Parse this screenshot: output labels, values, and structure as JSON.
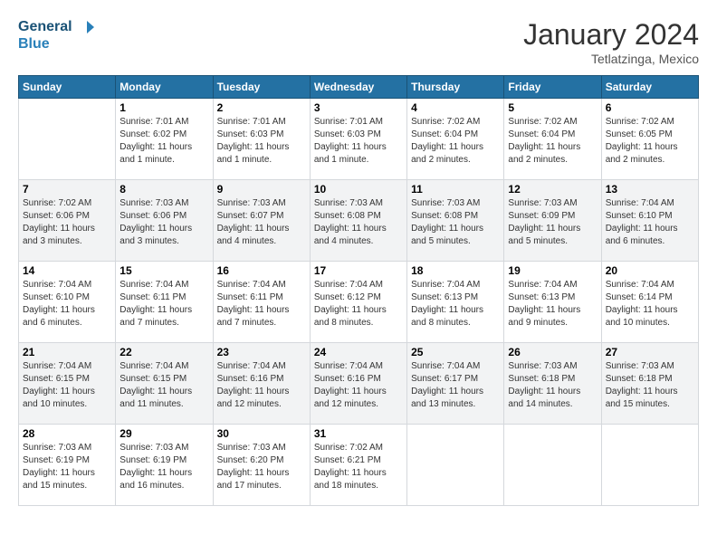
{
  "header": {
    "logo_text_general": "General",
    "logo_text_blue": "Blue",
    "month_year": "January 2024",
    "location": "Tetlatzinga, Mexico"
  },
  "days_of_week": [
    "Sunday",
    "Monday",
    "Tuesday",
    "Wednesday",
    "Thursday",
    "Friday",
    "Saturday"
  ],
  "weeks": [
    [
      {
        "day": "",
        "info": ""
      },
      {
        "day": "1",
        "info": "Sunrise: 7:01 AM\nSunset: 6:02 PM\nDaylight: 11 hours\nand 1 minute."
      },
      {
        "day": "2",
        "info": "Sunrise: 7:01 AM\nSunset: 6:03 PM\nDaylight: 11 hours\nand 1 minute."
      },
      {
        "day": "3",
        "info": "Sunrise: 7:01 AM\nSunset: 6:03 PM\nDaylight: 11 hours\nand 1 minute."
      },
      {
        "day": "4",
        "info": "Sunrise: 7:02 AM\nSunset: 6:04 PM\nDaylight: 11 hours\nand 2 minutes."
      },
      {
        "day": "5",
        "info": "Sunrise: 7:02 AM\nSunset: 6:04 PM\nDaylight: 11 hours\nand 2 minutes."
      },
      {
        "day": "6",
        "info": "Sunrise: 7:02 AM\nSunset: 6:05 PM\nDaylight: 11 hours\nand 2 minutes."
      }
    ],
    [
      {
        "day": "7",
        "info": "Sunrise: 7:02 AM\nSunset: 6:06 PM\nDaylight: 11 hours\nand 3 minutes."
      },
      {
        "day": "8",
        "info": "Sunrise: 7:03 AM\nSunset: 6:06 PM\nDaylight: 11 hours\nand 3 minutes."
      },
      {
        "day": "9",
        "info": "Sunrise: 7:03 AM\nSunset: 6:07 PM\nDaylight: 11 hours\nand 4 minutes."
      },
      {
        "day": "10",
        "info": "Sunrise: 7:03 AM\nSunset: 6:08 PM\nDaylight: 11 hours\nand 4 minutes."
      },
      {
        "day": "11",
        "info": "Sunrise: 7:03 AM\nSunset: 6:08 PM\nDaylight: 11 hours\nand 5 minutes."
      },
      {
        "day": "12",
        "info": "Sunrise: 7:03 AM\nSunset: 6:09 PM\nDaylight: 11 hours\nand 5 minutes."
      },
      {
        "day": "13",
        "info": "Sunrise: 7:04 AM\nSunset: 6:10 PM\nDaylight: 11 hours\nand 6 minutes."
      }
    ],
    [
      {
        "day": "14",
        "info": "Sunrise: 7:04 AM\nSunset: 6:10 PM\nDaylight: 11 hours\nand 6 minutes."
      },
      {
        "day": "15",
        "info": "Sunrise: 7:04 AM\nSunset: 6:11 PM\nDaylight: 11 hours\nand 7 minutes."
      },
      {
        "day": "16",
        "info": "Sunrise: 7:04 AM\nSunset: 6:11 PM\nDaylight: 11 hours\nand 7 minutes."
      },
      {
        "day": "17",
        "info": "Sunrise: 7:04 AM\nSunset: 6:12 PM\nDaylight: 11 hours\nand 8 minutes."
      },
      {
        "day": "18",
        "info": "Sunrise: 7:04 AM\nSunset: 6:13 PM\nDaylight: 11 hours\nand 8 minutes."
      },
      {
        "day": "19",
        "info": "Sunrise: 7:04 AM\nSunset: 6:13 PM\nDaylight: 11 hours\nand 9 minutes."
      },
      {
        "day": "20",
        "info": "Sunrise: 7:04 AM\nSunset: 6:14 PM\nDaylight: 11 hours\nand 10 minutes."
      }
    ],
    [
      {
        "day": "21",
        "info": "Sunrise: 7:04 AM\nSunset: 6:15 PM\nDaylight: 11 hours\nand 10 minutes."
      },
      {
        "day": "22",
        "info": "Sunrise: 7:04 AM\nSunset: 6:15 PM\nDaylight: 11 hours\nand 11 minutes."
      },
      {
        "day": "23",
        "info": "Sunrise: 7:04 AM\nSunset: 6:16 PM\nDaylight: 11 hours\nand 12 minutes."
      },
      {
        "day": "24",
        "info": "Sunrise: 7:04 AM\nSunset: 6:16 PM\nDaylight: 11 hours\nand 12 minutes."
      },
      {
        "day": "25",
        "info": "Sunrise: 7:04 AM\nSunset: 6:17 PM\nDaylight: 11 hours\nand 13 minutes."
      },
      {
        "day": "26",
        "info": "Sunrise: 7:03 AM\nSunset: 6:18 PM\nDaylight: 11 hours\nand 14 minutes."
      },
      {
        "day": "27",
        "info": "Sunrise: 7:03 AM\nSunset: 6:18 PM\nDaylight: 11 hours\nand 15 minutes."
      }
    ],
    [
      {
        "day": "28",
        "info": "Sunrise: 7:03 AM\nSunset: 6:19 PM\nDaylight: 11 hours\nand 15 minutes."
      },
      {
        "day": "29",
        "info": "Sunrise: 7:03 AM\nSunset: 6:19 PM\nDaylight: 11 hours\nand 16 minutes."
      },
      {
        "day": "30",
        "info": "Sunrise: 7:03 AM\nSunset: 6:20 PM\nDaylight: 11 hours\nand 17 minutes."
      },
      {
        "day": "31",
        "info": "Sunrise: 7:02 AM\nSunset: 6:21 PM\nDaylight: 11 hours\nand 18 minutes."
      },
      {
        "day": "",
        "info": ""
      },
      {
        "day": "",
        "info": ""
      },
      {
        "day": "",
        "info": ""
      }
    ]
  ]
}
